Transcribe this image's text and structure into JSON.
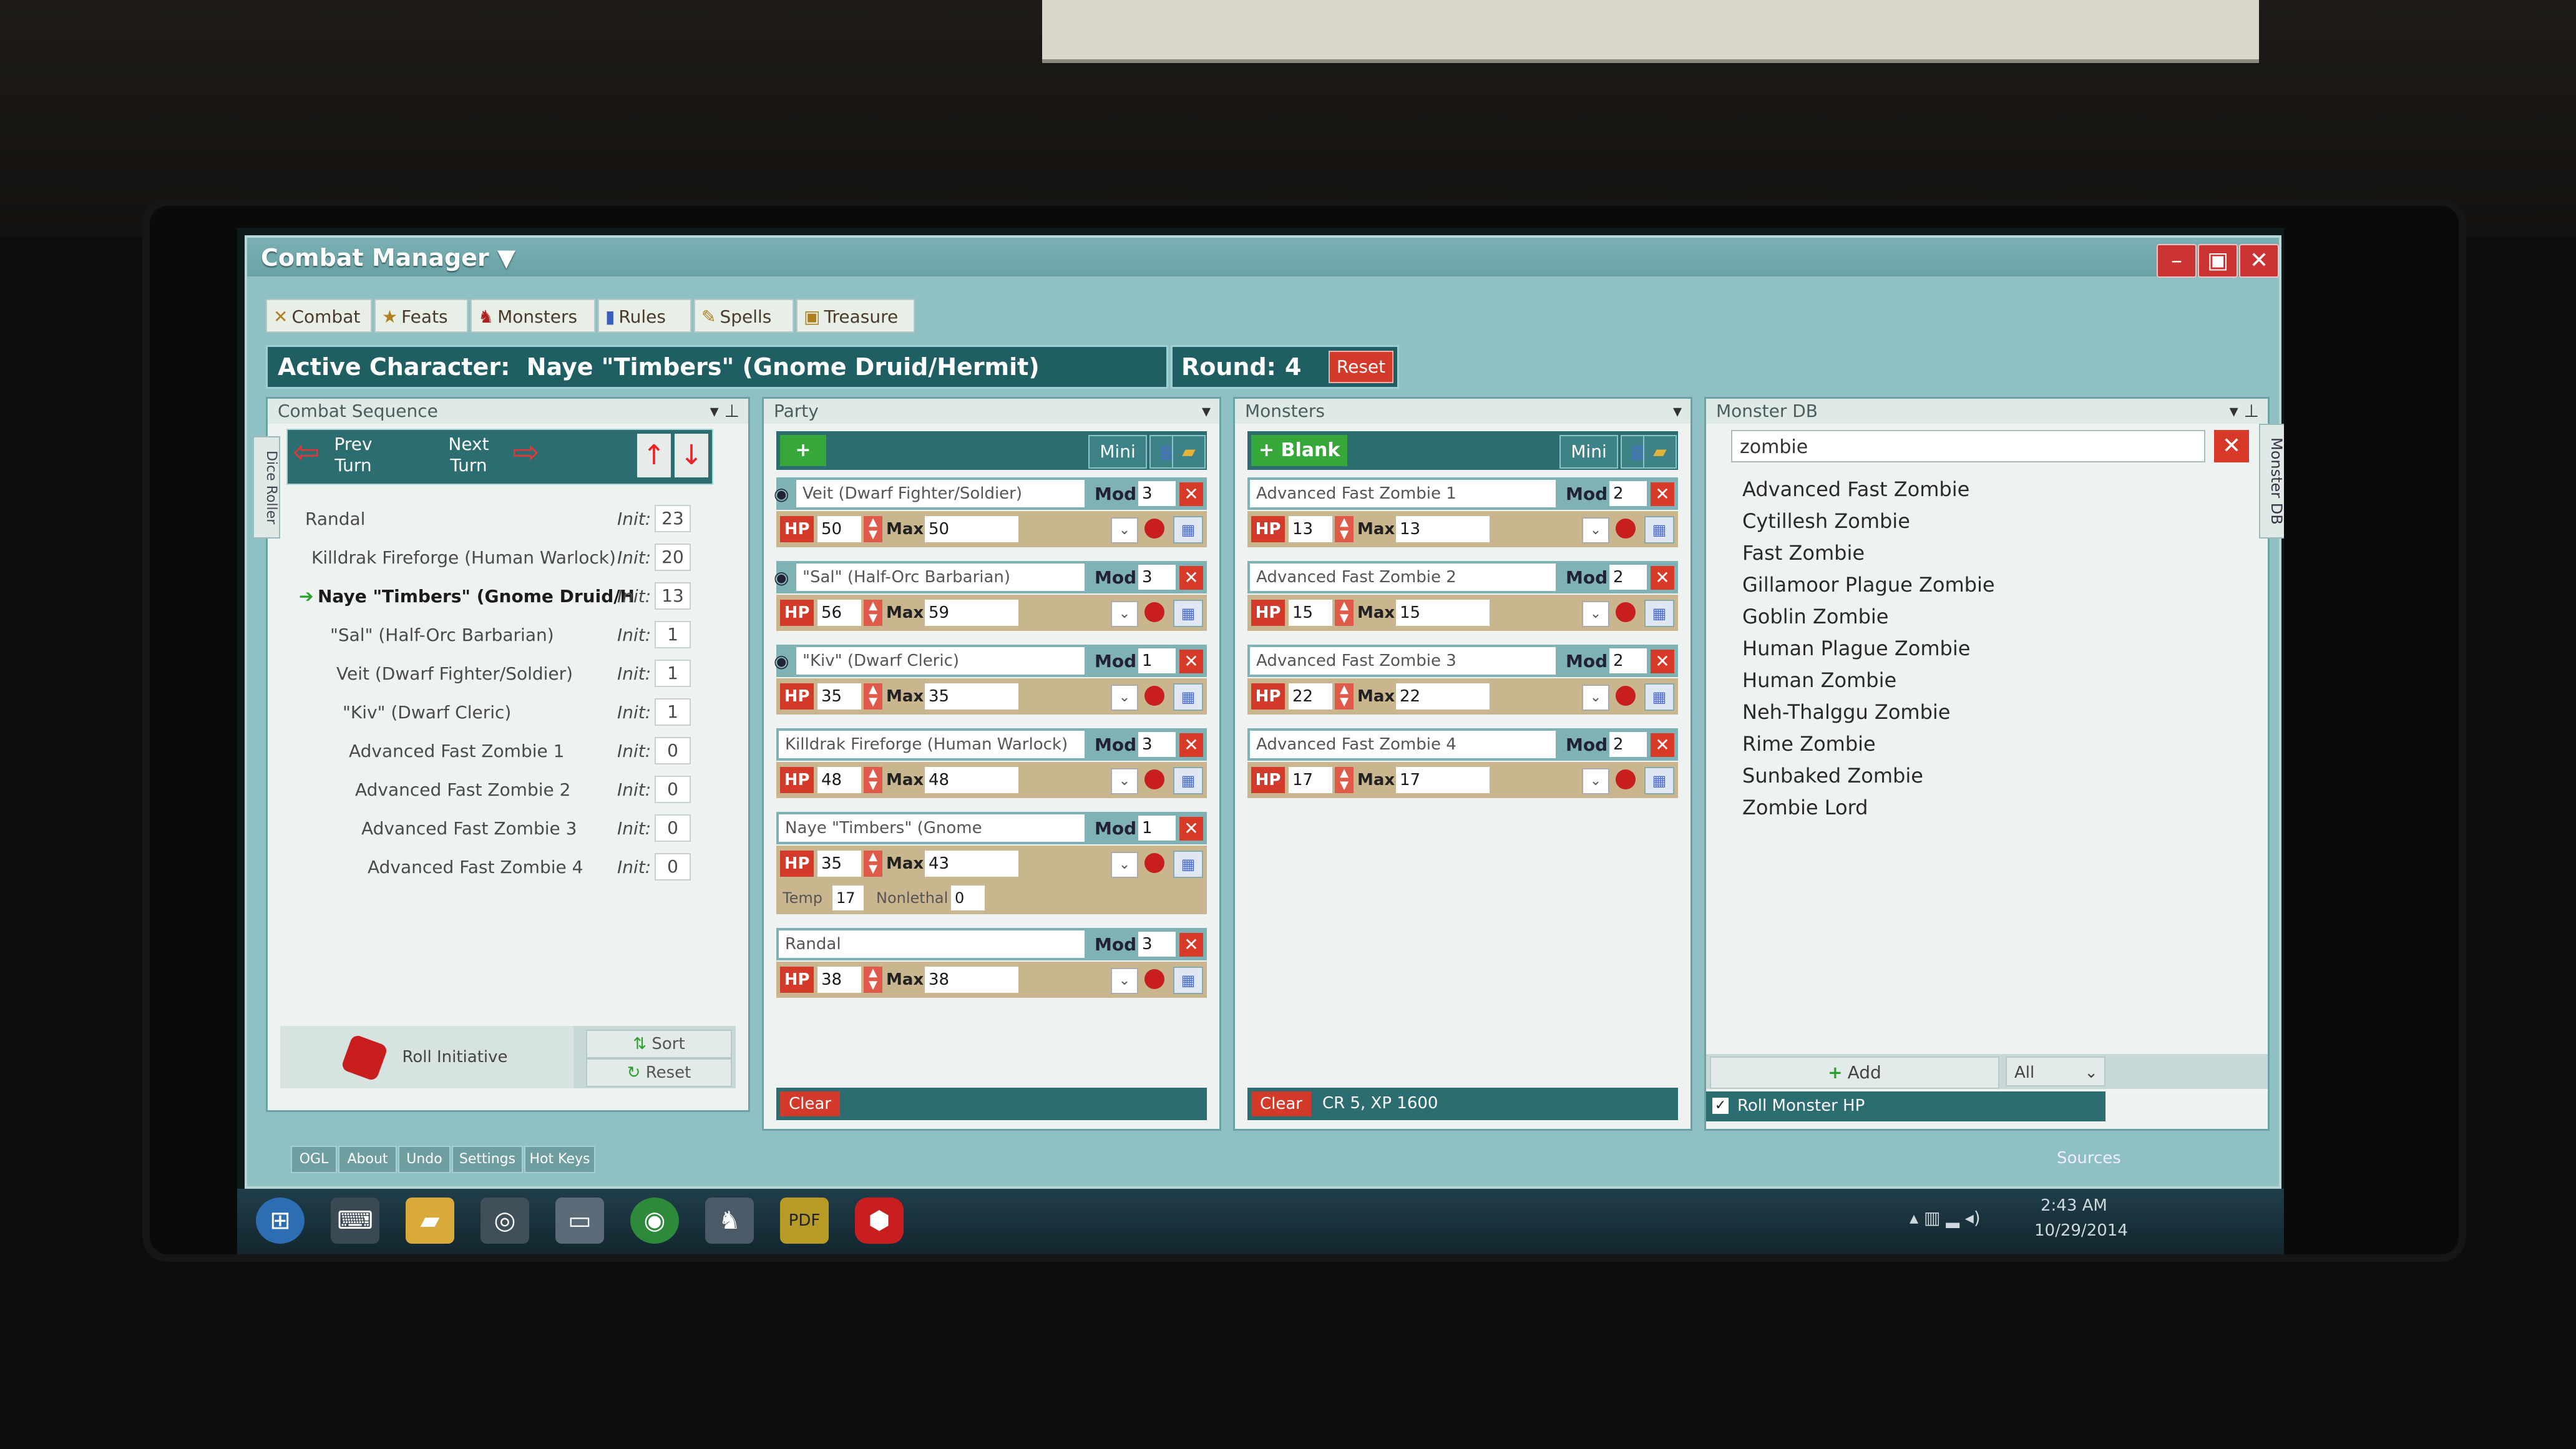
{
  "window": {
    "title": "Combat Manager ▼",
    "minimize_icon": "minimize-icon",
    "maximize_icon": "maximize-icon",
    "close_icon": "close-icon"
  },
  "nav_tabs": [
    {
      "label": "Combat",
      "icon": "crossed-swords-icon"
    },
    {
      "label": "Feats",
      "icon": "star-icon"
    },
    {
      "label": "Monsters",
      "icon": "monster-icon"
    },
    {
      "label": "Rules",
      "icon": "book-icon"
    },
    {
      "label": "Spells",
      "icon": "scroll-icon"
    },
    {
      "label": "Treasure",
      "icon": "chest-icon"
    }
  ],
  "active_character": {
    "label": "Active Character:",
    "name": "Naye \"Timbers\" (Gnome Druid/Hermit)"
  },
  "round": {
    "label": "Round:",
    "value": "4",
    "reset_label": "Reset"
  },
  "combat_sequence": {
    "header": "Combat Sequence",
    "dice_roller_tab": "Dice Roller",
    "prev_turn": "Prev\nTurn",
    "next_turn": "Next\nTurn",
    "init_label": "Init:",
    "entries": [
      {
        "name": "Randal",
        "init": "23"
      },
      {
        "name": "Killdrak Fireforge (Human Warlock)",
        "init": "20"
      },
      {
        "name": "Naye \"Timbers\" (Gnome Druid/H",
        "init": "13",
        "active": true
      },
      {
        "name": "\"Sal\" (Half-Orc Barbarian)",
        "init": "1"
      },
      {
        "name": "Veit (Dwarf Fighter/Soldier)",
        "init": "1"
      },
      {
        "name": "\"Kiv\" (Dwarf Cleric)",
        "init": "1"
      },
      {
        "name": "Advanced Fast Zombie 1",
        "init": "0"
      },
      {
        "name": "Advanced Fast Zombie 2",
        "init": "0"
      },
      {
        "name": "Advanced Fast Zombie 3",
        "init": "0"
      },
      {
        "name": "Advanced Fast Zombie 4",
        "init": "0"
      }
    ],
    "roll_initiative": "Roll Initiative",
    "sort_label": "Sort",
    "reset_label": "Reset"
  },
  "party": {
    "header": "Party",
    "mini_label": "Mini",
    "mod_label": "Mod",
    "hp_label": "HP",
    "max_label": "Max",
    "temp_label": "Temp",
    "nonlethal_label": "Nonlethal",
    "clear_label": "Clear",
    "members": [
      {
        "name": "Veit (Dwarf Fighter/Soldier)",
        "mod": "3",
        "hp": "50",
        "max": "50"
      },
      {
        "name": "\"Sal\" (Half-Orc Barbarian)",
        "mod": "3",
        "hp": "56",
        "max": "59"
      },
      {
        "name": "\"Kiv\" (Dwarf Cleric)",
        "mod": "1",
        "hp": "35",
        "max": "35"
      },
      {
        "name": "Killdrak Fireforge (Human Warlock)",
        "mod": "3",
        "hp": "48",
        "max": "48"
      },
      {
        "name": "Naye \"Timbers\" (Gnome Druid/Hermit)",
        "mod": "1",
        "hp": "35",
        "max": "43",
        "temp": "17",
        "nonlethal": "0"
      },
      {
        "name": "Randal",
        "mod": "3",
        "hp": "38",
        "max": "38"
      }
    ]
  },
  "monsters": {
    "header": "Monsters",
    "blank_label": "Blank",
    "mini_label": "Mini",
    "mod_label": "Mod",
    "hp_label": "HP",
    "max_label": "Max",
    "clear_label": "Clear",
    "cr_xp": "CR 5, XP 1600",
    "entries": [
      {
        "name": "Advanced Fast Zombie 1",
        "mod": "2",
        "hp": "13",
        "max": "13"
      },
      {
        "name": "Advanced Fast Zombie 2",
        "mod": "2",
        "hp": "15",
        "max": "15"
      },
      {
        "name": "Advanced Fast Zombie 3",
        "mod": "2",
        "hp": "22",
        "max": "22"
      },
      {
        "name": "Advanced Fast Zombie 4",
        "mod": "2",
        "hp": "17",
        "max": "17"
      }
    ]
  },
  "monster_db": {
    "header": "Monster DB",
    "side_tab": "Monster DB",
    "search_value": "zombie",
    "results": [
      "Advanced Fast Zombie",
      "Cytillesh Zombie",
      "Fast Zombie",
      "Gillamoor Plague Zombie",
      "Goblin Zombie",
      "Human Plague Zombie",
      "Human Zombie",
      "Neh-Thalggu Zombie",
      "Rime Zombie",
      "Sunbaked Zombie",
      "Zombie Lord"
    ],
    "add_label": "Add",
    "filter_value": "All",
    "roll_hp_label": "Roll Monster HP"
  },
  "bottom_tabs": [
    "OGL",
    "About",
    "Undo",
    "Settings",
    "Hot Keys"
  ],
  "sources_label": "Sources",
  "taskbar": {
    "time": "2:43 AM",
    "date": "10/29/2014",
    "pdf_label": "PDF"
  },
  "colors": {
    "window_bg": "#8fc0c3",
    "header_teal": "#1f5f63",
    "hp_band": "#c9b68e",
    "danger_red": "#d33a2a"
  }
}
